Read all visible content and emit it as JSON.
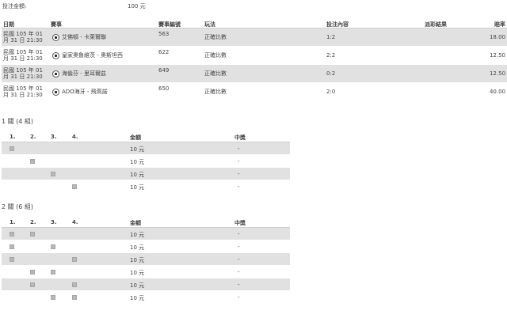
{
  "bet_amount": {
    "label": "投注金額:",
    "value": "100 元"
  },
  "match_table": {
    "headers": {
      "date": "日期",
      "match": "賽事",
      "code": "賽事編號",
      "play": "玩法",
      "bet": "投注內容",
      "result": "派彩結果",
      "odds": "賠率"
    },
    "rows": [
      {
        "date": "民國 105 年 01 月 31 日 21:30",
        "teams": "艾佛頓 - 卡萊爾聯",
        "code": "563",
        "play": "正確比數",
        "bet": "1:2",
        "result": "",
        "odds": "18.00"
      },
      {
        "date": "民國 105 年 01 月 31 日 21:30",
        "teams": "皇家奧魯維茨 - 奧斯坦西",
        "code": "622",
        "play": "正確比數",
        "bet": "2:2",
        "result": "",
        "odds": "12.50"
      },
      {
        "date": "民國 105 年 01 月 31 日 21:30",
        "teams": "海倫芬 - 里耳爾茲",
        "code": "649",
        "play": "正確比數",
        "bet": "0:2",
        "result": "",
        "odds": "12.50"
      },
      {
        "date": "民國 105 年 01 月 31 日 21:30",
        "teams": "ADO海牙 - 飛燕諾",
        "code": "650",
        "play": "正確比數",
        "bet": "2:0",
        "result": "",
        "odds": "40.00"
      }
    ]
  },
  "combo1": {
    "title": "1 關 (4 組)",
    "headers": {
      "c1": "1.",
      "c2": "2.",
      "c3": "3.",
      "c4": "4.",
      "amount": "金額",
      "win": "中獎"
    },
    "rows": [
      {
        "marks": [
          1,
          0,
          0,
          0
        ],
        "amount": "10 元",
        "win": "-"
      },
      {
        "marks": [
          0,
          1,
          0,
          0
        ],
        "amount": "10 元",
        "win": "-"
      },
      {
        "marks": [
          0,
          0,
          1,
          0
        ],
        "amount": "10 元",
        "win": "-"
      },
      {
        "marks": [
          0,
          0,
          0,
          1
        ],
        "amount": "10 元",
        "win": "-"
      }
    ]
  },
  "combo2": {
    "title": "2 關 (6 組)",
    "headers": {
      "c1": "1.",
      "c2": "2.",
      "c3": "3.",
      "c4": "4.",
      "amount": "金額",
      "win": "中獎"
    },
    "rows": [
      {
        "marks": [
          1,
          1,
          0,
          0
        ],
        "amount": "10 元",
        "win": "-"
      },
      {
        "marks": [
          1,
          0,
          1,
          0
        ],
        "amount": "10 元",
        "win": "-"
      },
      {
        "marks": [
          1,
          0,
          0,
          1
        ],
        "amount": "10 元",
        "win": "-"
      },
      {
        "marks": [
          0,
          1,
          1,
          0
        ],
        "amount": "10 元",
        "win": "-"
      },
      {
        "marks": [
          0,
          1,
          0,
          1
        ],
        "amount": "10 元",
        "win": "-"
      },
      {
        "marks": [
          0,
          0,
          1,
          1
        ],
        "amount": "10 元",
        "win": "-"
      }
    ]
  }
}
